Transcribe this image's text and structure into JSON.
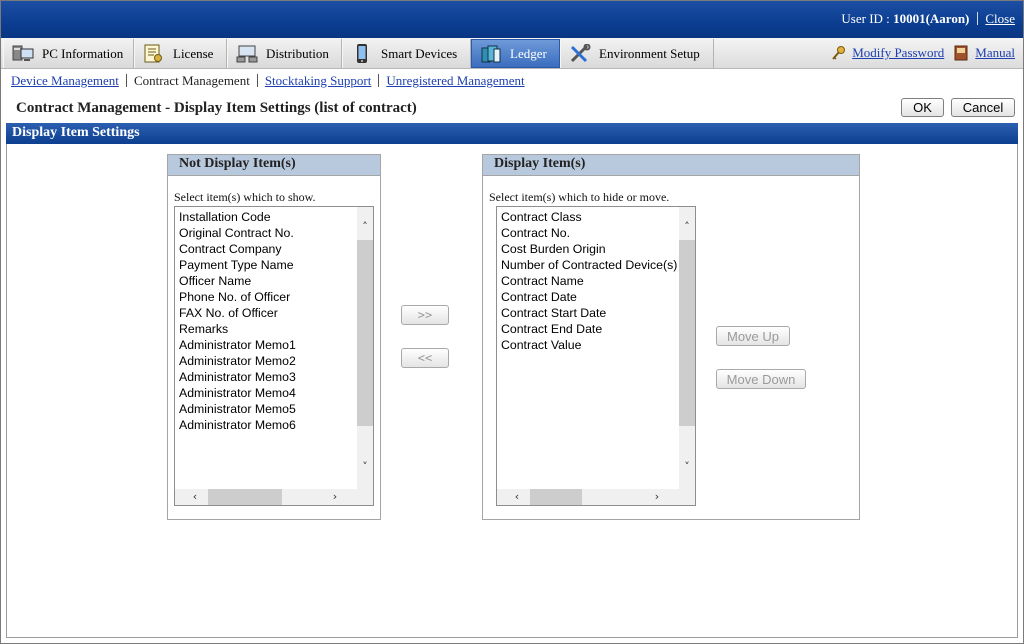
{
  "header": {
    "user_label": "User ID : ",
    "user_value": "10001(Aaron)",
    "close_label": "Close"
  },
  "tabs": [
    {
      "label": "PC Information",
      "icon": "pc-icon"
    },
    {
      "label": "License",
      "icon": "license-icon"
    },
    {
      "label": "Distribution",
      "icon": "distribution-icon"
    },
    {
      "label": "Smart Devices",
      "icon": "smartphone-icon"
    },
    {
      "label": "Ledger",
      "icon": "ledger-book-icon",
      "active": true
    },
    {
      "label": "Environment Setup",
      "icon": "tools-icon"
    }
  ],
  "toplinks": {
    "modify_password": "Modify Password",
    "manual": "Manual"
  },
  "subnav": {
    "device_management": "Device Management",
    "contract_management": "Contract Management",
    "stocktaking_support": "Stocktaking Support",
    "unregistered_management": "Unregistered Management"
  },
  "page": {
    "title": "Contract Management - Display Item Settings (list of contract)",
    "ok_label": "OK",
    "cancel_label": "Cancel",
    "section_title": "Display Item Settings"
  },
  "not_display": {
    "heading": "Not Display Item(s)",
    "hint": "Select item(s) which to show.",
    "items": [
      "Installation Code",
      "Original Contract No.",
      "Contract Company",
      "Payment Type Name",
      "Officer Name",
      "Phone No. of Officer",
      "FAX No. of Officer",
      "Remarks",
      "Administrator Memo1",
      "Administrator Memo2",
      "Administrator Memo3",
      "Administrator Memo4",
      "Administrator Memo5",
      "Administrator Memo6"
    ]
  },
  "display": {
    "heading": "Display Item(s)",
    "hint": "Select item(s) which to hide or move.",
    "items": [
      "Contract Class",
      "Contract No.",
      "Cost Burden Origin",
      "Number of Contracted Device(s)",
      "Contract Name",
      "Contract Date",
      "Contract Start Date",
      "Contract End Date",
      "Contract Value"
    ]
  },
  "transfer": {
    "add_label": ">>",
    "remove_label": "<<"
  },
  "order": {
    "move_up_label": "Move Up",
    "move_down_label": "Move Down"
  },
  "colors": {
    "header_blue": "#0b3d91",
    "section_blue": "#0d3f91",
    "panel_head": "#b9c9dd",
    "link": "#1d3fb0"
  }
}
